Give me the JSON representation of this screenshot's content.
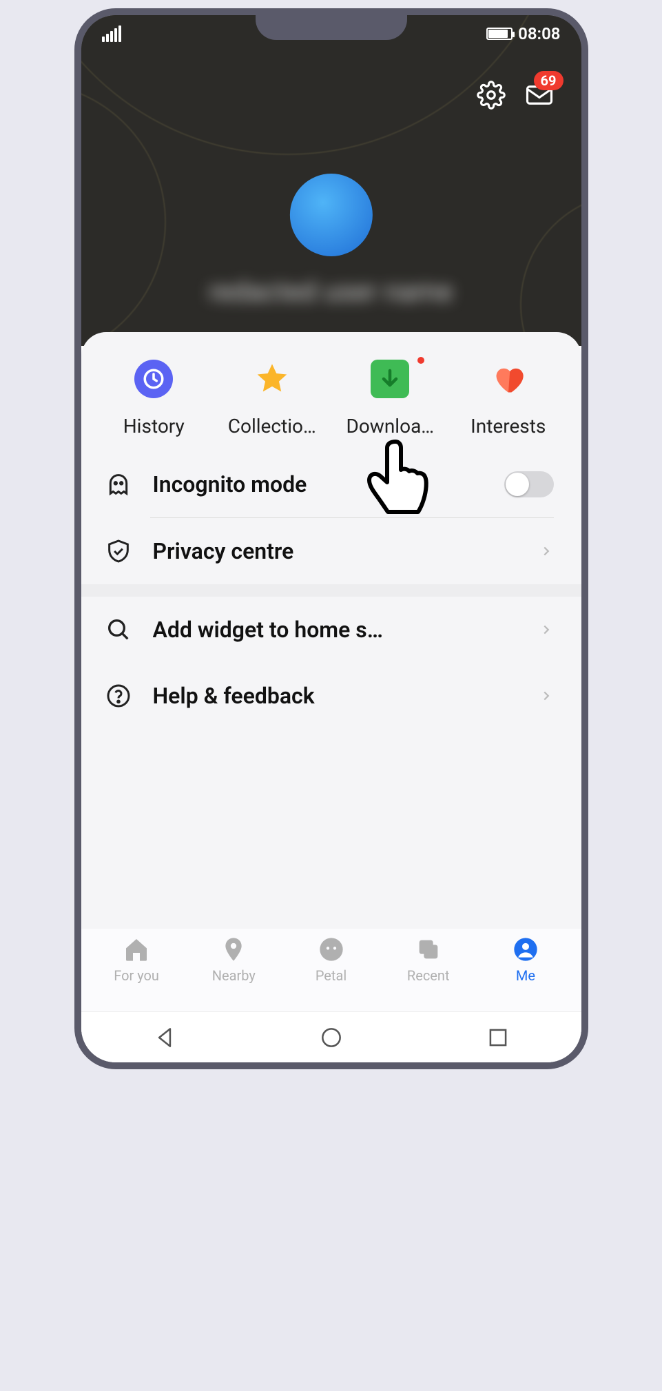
{
  "status": {
    "time": "08:08"
  },
  "header": {
    "notification_count": "69",
    "username_placeholder": "redacted user name"
  },
  "quick": [
    {
      "label": "History"
    },
    {
      "label": "Collectio…"
    },
    {
      "label": "Downloa…"
    },
    {
      "label": "Interests"
    }
  ],
  "list_a": [
    {
      "label": "Incognito mode"
    },
    {
      "label": "Privacy centre"
    }
  ],
  "list_b": [
    {
      "label": "Add widget to home s…"
    },
    {
      "label": "Help & feedback"
    }
  ],
  "bottom": [
    {
      "label": "For you"
    },
    {
      "label": "Nearby"
    },
    {
      "label": "Petal"
    },
    {
      "label": "Recent"
    },
    {
      "label": "Me"
    }
  ],
  "colors": {
    "accent": "#1f6ff0",
    "badge": "#f03a2e"
  }
}
